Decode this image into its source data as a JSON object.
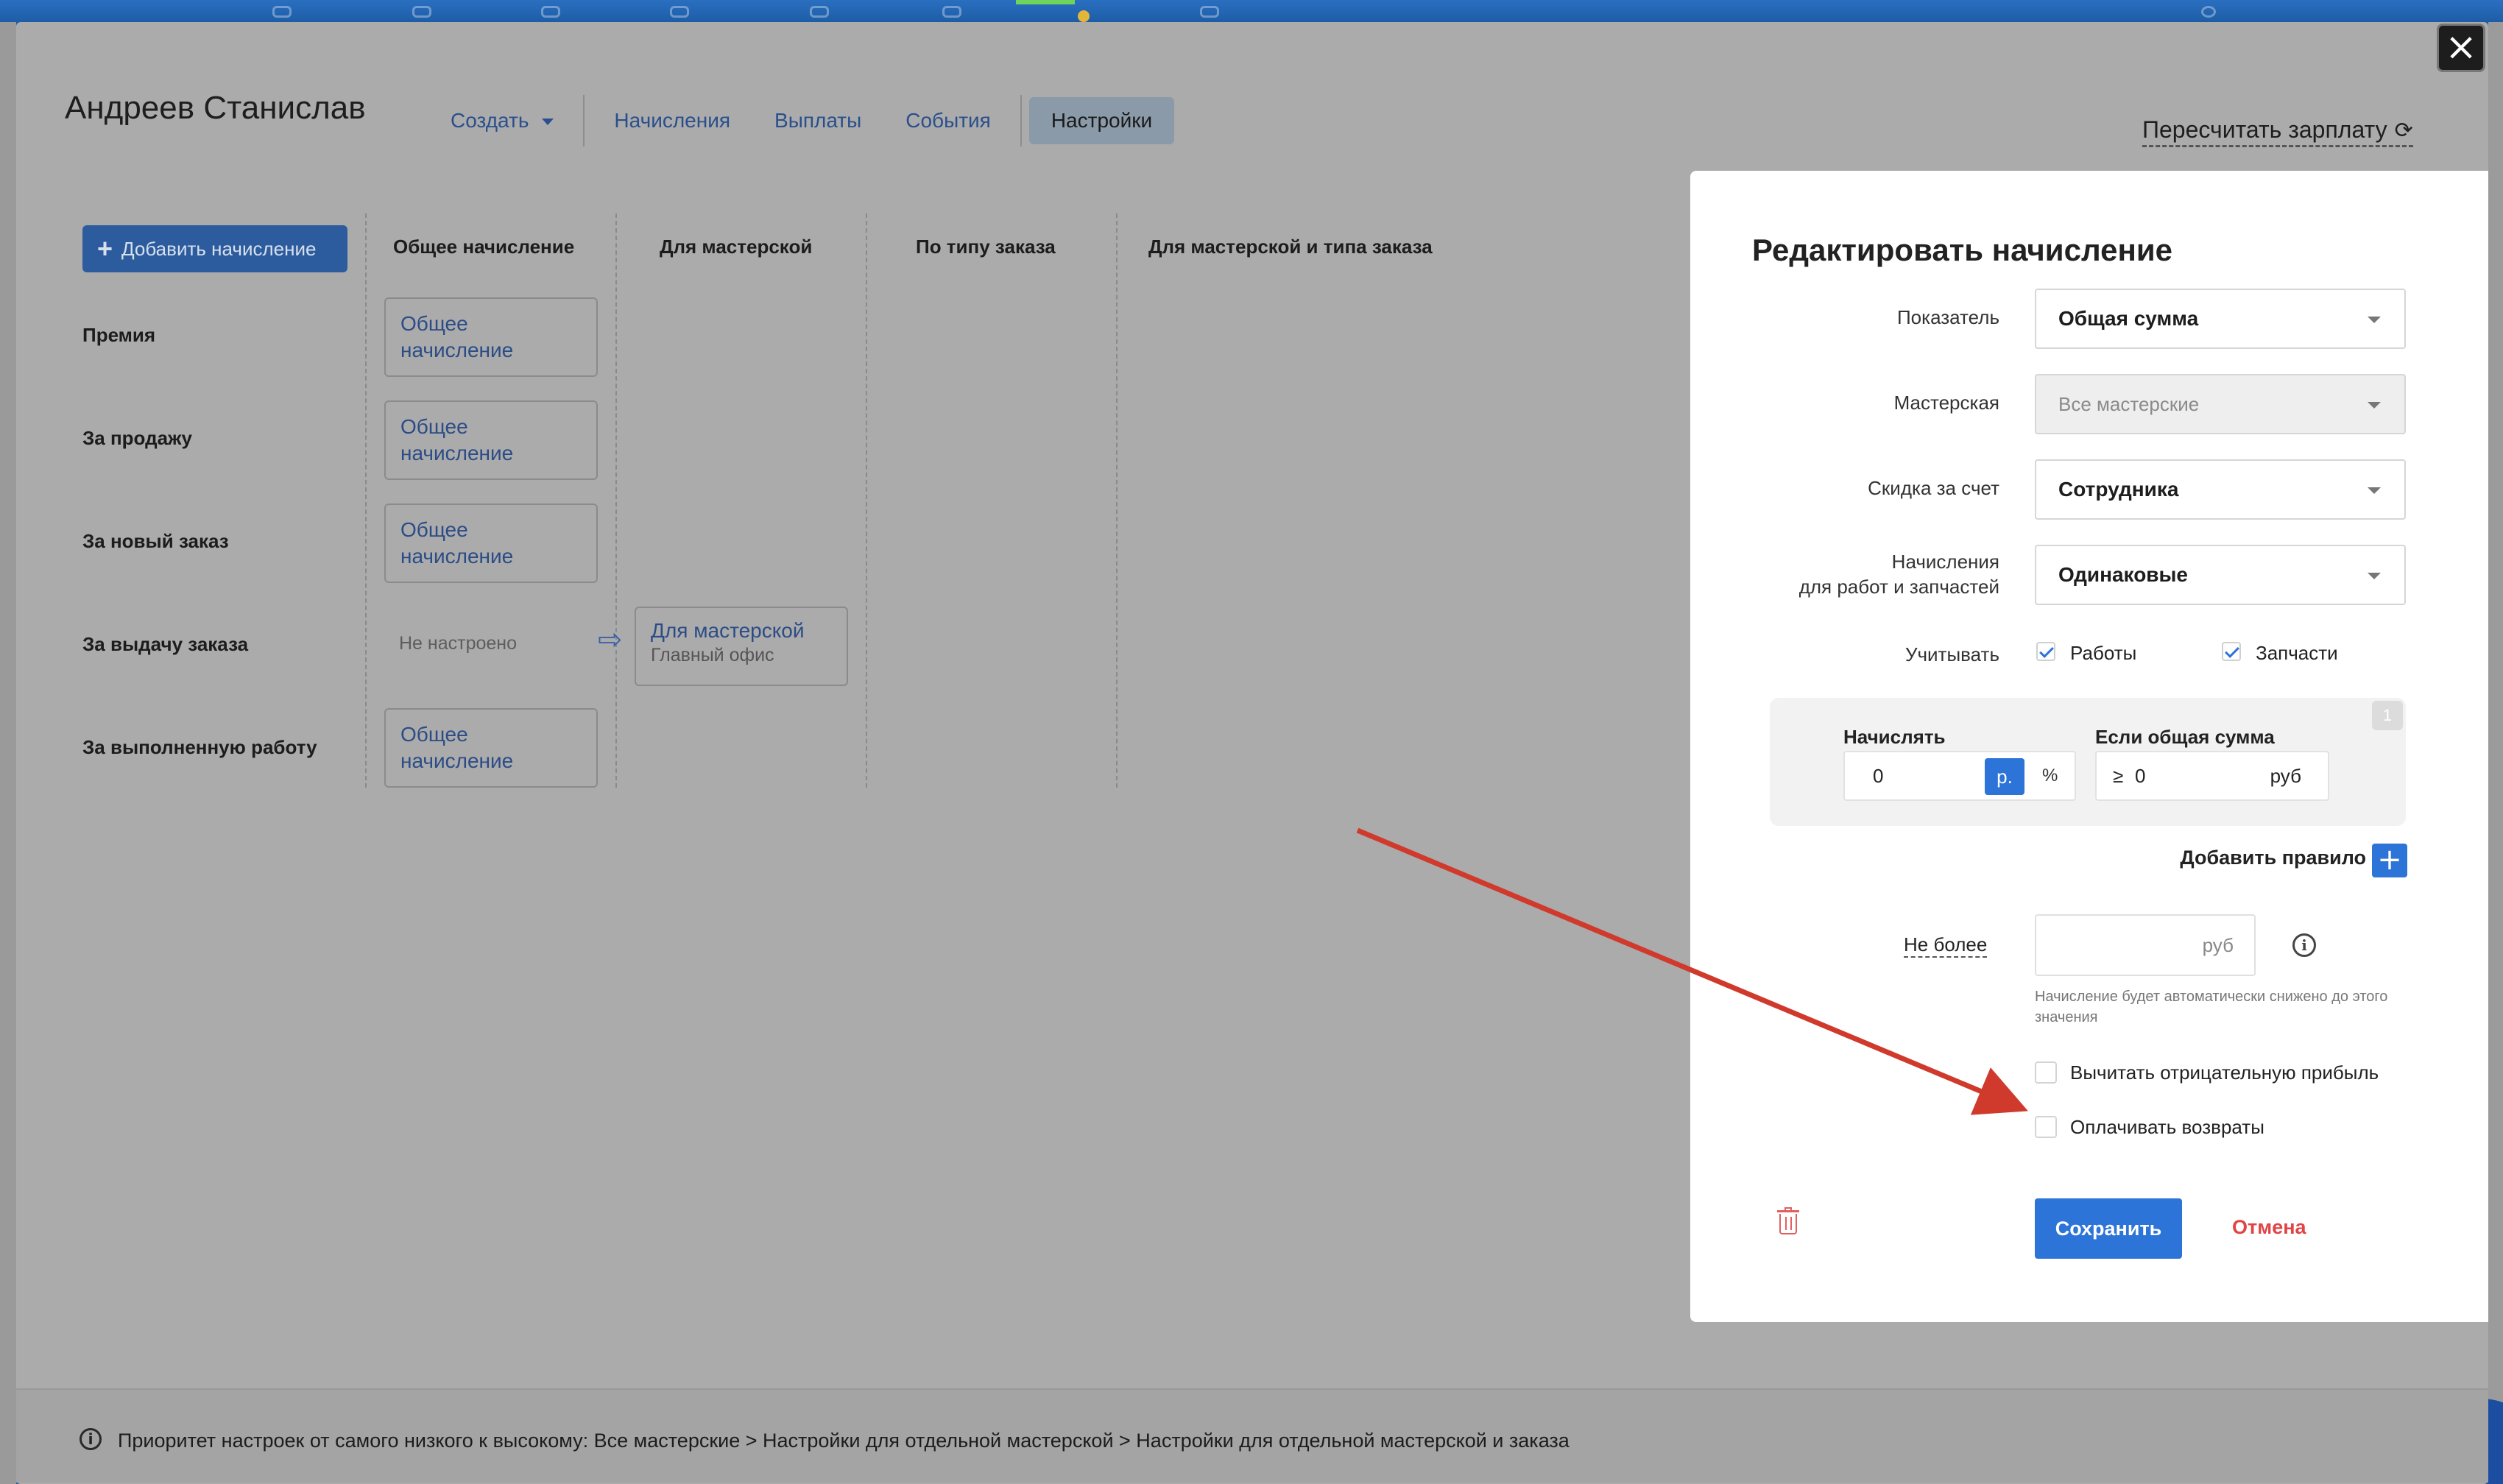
{
  "employee": {
    "name": "Андреев Станислав"
  },
  "nav": {
    "create": "Создать",
    "accruals": "Начисления",
    "payouts": "Выплаты",
    "events": "События",
    "settings": "Настройки"
  },
  "recalc_label": "Пересчитать зарплату",
  "grid": {
    "add_button": "Добавить начисление",
    "columns": [
      "Общее начисление",
      "Для мастерской",
      "По типу заказа",
      "Для мастерской и типа заказа"
    ],
    "rows": [
      {
        "label": "Премия",
        "general": "Общее начисление"
      },
      {
        "label": "За продажу",
        "general": "Общее начисление"
      },
      {
        "label": "За новый заказ",
        "general": "Общее начисление"
      },
      {
        "label": "За выдачу заказа",
        "general": "Не настроено",
        "shop_title": "Для мастерской",
        "shop_sub": "Главный офис"
      },
      {
        "label": "За выполненную работу",
        "general": "Общее начисление"
      }
    ]
  },
  "footer": {
    "text": "Приоритет настроек от самого низкого к высокому: Все мастерские > Настройки для отдельной мастерской > Настройки для отдельной мастерской и заказа"
  },
  "panel": {
    "title": "Редактировать начисление",
    "indicator": {
      "label": "Показатель",
      "value": "Общая сумма"
    },
    "workshop": {
      "label": "Мастерская",
      "value": "Все мастерские"
    },
    "discount": {
      "label": "Скидка за счет",
      "value": "Сотрудника"
    },
    "accruals_for": {
      "label_line1": "Начисления",
      "label_line2": "для работ и запчастей",
      "value": "Одинаковые"
    },
    "consider": {
      "label": "Учитывать",
      "works": "Работы",
      "parts": "Запчасти"
    },
    "rule": {
      "number": "1",
      "accrue_label": "Начислять",
      "accrue_value": "0",
      "unit_rub": "р.",
      "unit_pct": "%",
      "if_total_label": "Если общая сумма",
      "gte": "≥",
      "if_total_value": "0",
      "if_total_unit": "руб"
    },
    "add_rule": "Добавить правило",
    "max": {
      "label": "Не более",
      "unit": "руб",
      "hint": "Начисление будет автоматически снижено до этого значения"
    },
    "deduct_negative": "Вычитать отрицательную прибыль",
    "pay_returns": "Оплачивать возвраты",
    "save": "Сохранить",
    "cancel": "Отмена"
  },
  "colors": {
    "accent": "#2d74d9",
    "danger": "#e04444",
    "annotation_arrow": "#d03a2c"
  }
}
